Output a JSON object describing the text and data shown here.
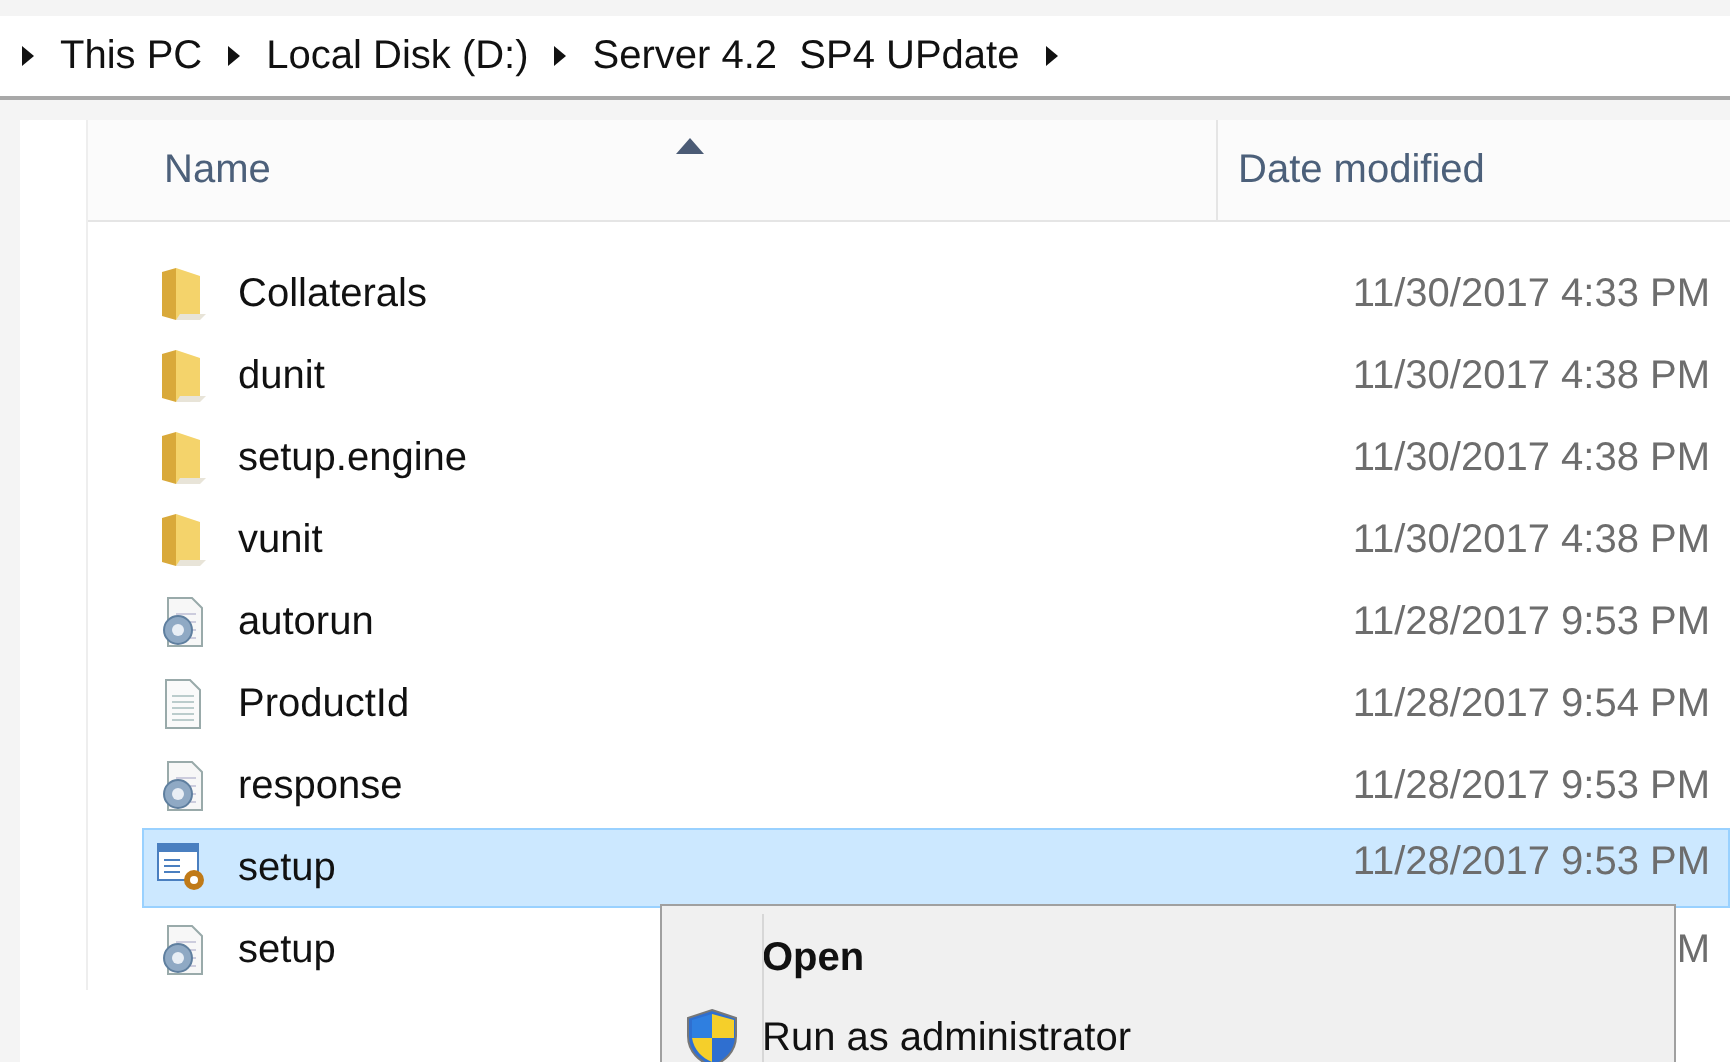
{
  "breadcrumb": [
    "This PC",
    "Local Disk (D:)",
    "Server 4.2  SP4 UPdate"
  ],
  "columns": [
    {
      "label": "Name",
      "sorted": true
    },
    {
      "label": "Date modified",
      "sorted": false
    }
  ],
  "rows": [
    {
      "kind": "folder",
      "name": "Collaterals",
      "date": "11/30/2017 4:33 PM",
      "selected": false
    },
    {
      "kind": "folder",
      "name": "dunit",
      "date": "11/30/2017 4:38 PM",
      "selected": false
    },
    {
      "kind": "folder",
      "name": "setup.engine",
      "date": "11/30/2017 4:38 PM",
      "selected": false
    },
    {
      "kind": "folder",
      "name": "vunit",
      "date": "11/30/2017 4:38 PM",
      "selected": false
    },
    {
      "kind": "settings",
      "name": "autorun",
      "date": "11/28/2017 9:53 PM",
      "selected": false
    },
    {
      "kind": "text",
      "name": "ProductId",
      "date": "11/28/2017 9:54 PM",
      "selected": false
    },
    {
      "kind": "settings",
      "name": "response",
      "date": "11/28/2017 9:53 PM",
      "selected": false
    },
    {
      "kind": "app",
      "name": "setup",
      "date": "11/28/2017 9:53 PM",
      "selected": true
    },
    {
      "kind": "settings",
      "name": "setup",
      "date": "M",
      "selected": false
    }
  ],
  "context_menu": [
    {
      "kind": "default",
      "label": "Open"
    },
    {
      "kind": "elevated",
      "label": "Run as administrator"
    }
  ]
}
